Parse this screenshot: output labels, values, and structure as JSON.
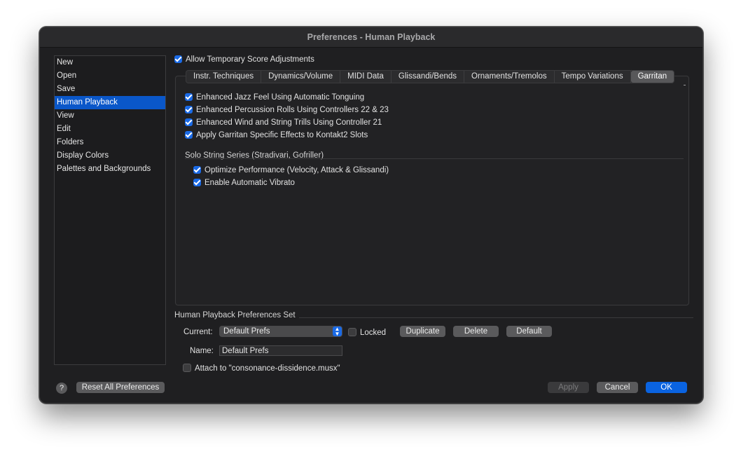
{
  "window": {
    "title": "Preferences - Human Playback"
  },
  "sidebar": {
    "items": [
      {
        "label": "New"
      },
      {
        "label": "Open"
      },
      {
        "label": "Save"
      },
      {
        "label": "Human Playback"
      },
      {
        "label": "View"
      },
      {
        "label": "Edit"
      },
      {
        "label": "Folders"
      },
      {
        "label": "Display Colors"
      },
      {
        "label": "Palettes and Backgrounds"
      }
    ],
    "selected": "Human Playback"
  },
  "main": {
    "allow_adjustments": {
      "label": "Allow Temporary Score Adjustments",
      "checked": true
    },
    "tabs": [
      {
        "label": "Instr. Techniques"
      },
      {
        "label": "Dynamics/Volume"
      },
      {
        "label": "MIDI Data"
      },
      {
        "label": "Glissandi/Bends"
      },
      {
        "label": "Ornaments/Tremolos"
      },
      {
        "label": "Tempo Variations"
      },
      {
        "label": "Garritan"
      }
    ],
    "active_tab": "Garritan",
    "garritan_options": [
      {
        "label": "Enhanced Jazz Feel Using Automatic Tonguing",
        "checked": true
      },
      {
        "label": "Enhanced Percussion Rolls Using Controllers 22 & 23",
        "checked": true
      },
      {
        "label": "Enhanced Wind and String Trills Using Controller 21",
        "checked": true
      },
      {
        "label": "Apply Garritan Specific Effects to Kontakt2 Slots",
        "checked": true
      }
    ],
    "solo_strings": {
      "heading": "Solo String Series (Stradivari, Gofriller)",
      "options": [
        {
          "label": "Optimize Performance (Velocity, Attack & Glissandi)",
          "checked": true
        },
        {
          "label": "Enable Automatic Vibrato",
          "checked": true
        }
      ]
    }
  },
  "prefs_set": {
    "heading": "Human Playback Preferences Set",
    "current_label": "Current:",
    "current_value": "Default Prefs",
    "locked_label": "Locked",
    "locked_checked": false,
    "duplicate_label": "Duplicate",
    "delete_label": "Delete",
    "default_label": "Default",
    "name_label": "Name:",
    "name_value": "Default Prefs",
    "attach_label": "Attach to \"consonance-dissidence.musx\"",
    "attach_checked": false
  },
  "footer": {
    "help_label": "?",
    "reset_label": "Reset All Preferences",
    "apply_label": "Apply",
    "cancel_label": "Cancel",
    "ok_label": "OK"
  },
  "colors": {
    "accent": "#0a63e0",
    "selection": "#0a57c9",
    "window_bg": "#1f1f21"
  }
}
